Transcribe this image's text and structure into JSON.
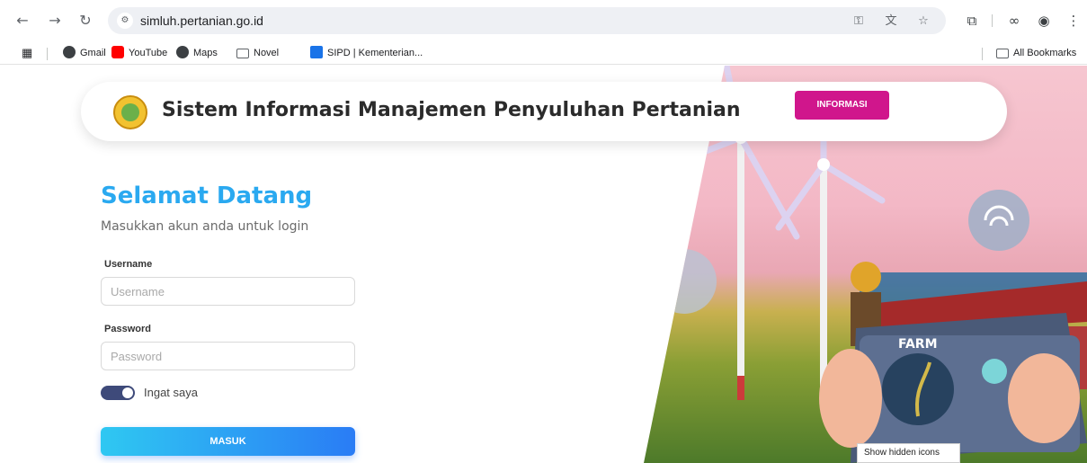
{
  "browser": {
    "url": "simluh.pertanian.go.id",
    "bookmarks": [
      "Gmail",
      "YouTube",
      "Maps",
      "Novel",
      "SIPD | Kementerian..."
    ],
    "all_bookmarks": "All Bookmarks"
  },
  "header": {
    "title": "Sistem Informasi Manajemen Penyuluhan Pertanian",
    "info_button": "INFORMASI"
  },
  "login": {
    "heading": "Selamat Datang",
    "subtitle": "Masukkan akun anda untuk login",
    "username_label": "Username",
    "username_placeholder": "Username",
    "password_label": "Password",
    "password_placeholder": "Password",
    "remember_label": "Ingat saya",
    "remember_checked": true,
    "submit_label": "MASUK"
  },
  "hero": {
    "farm_label": "FARM"
  },
  "taskbar_tooltip": "Show hidden icons",
  "colors": {
    "brand_blue": "#2aa9f0",
    "info_magenta": "#d0168c",
    "toggle": "#3e4a7a"
  }
}
